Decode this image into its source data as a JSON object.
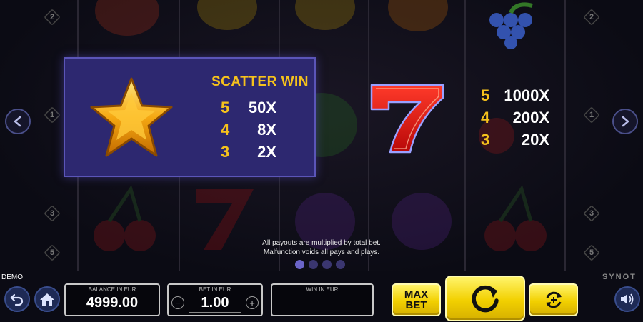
{
  "scatter_panel": {
    "title": "SCATTER WIN",
    "symbol": "star-icon",
    "payouts": [
      {
        "count": "5",
        "multiplier": "50X"
      },
      {
        "count": "4",
        "multiplier": "8X"
      },
      {
        "count": "3",
        "multiplier": "2X"
      }
    ]
  },
  "seven_panel": {
    "symbol": "seven-icon",
    "payouts": [
      {
        "count": "5",
        "multiplier": "1000X"
      },
      {
        "count": "4",
        "multiplier": "200X"
      },
      {
        "count": "3",
        "multiplier": "20X"
      }
    ]
  },
  "row_numbers": {
    "left": [
      "2",
      "1",
      "3",
      "5"
    ],
    "right": [
      "2",
      "1",
      "3",
      "5"
    ]
  },
  "info": {
    "line1": "All payouts are multiplied by total bet.",
    "line2": "Malfunction voids all pays and plays."
  },
  "pagination": {
    "pages": 4,
    "current": 1
  },
  "bottom_bar": {
    "demo_label": "DEMO",
    "brand": "SYNOT",
    "balance_label": "BALANCE IN EUR",
    "balance_value": "4999.00",
    "bet_label": "BET IN EUR",
    "bet_value": "1.00",
    "bet_minus": "−",
    "bet_plus": "+",
    "win_label": "WIN IN EUR",
    "win_value": "",
    "max_bet_line1": "MAX",
    "max_bet_line2": "BET"
  },
  "colors": {
    "panel_bg": "#2d2870",
    "accent_yellow": "#f6c21c",
    "button_yellow": "#f2d000"
  }
}
